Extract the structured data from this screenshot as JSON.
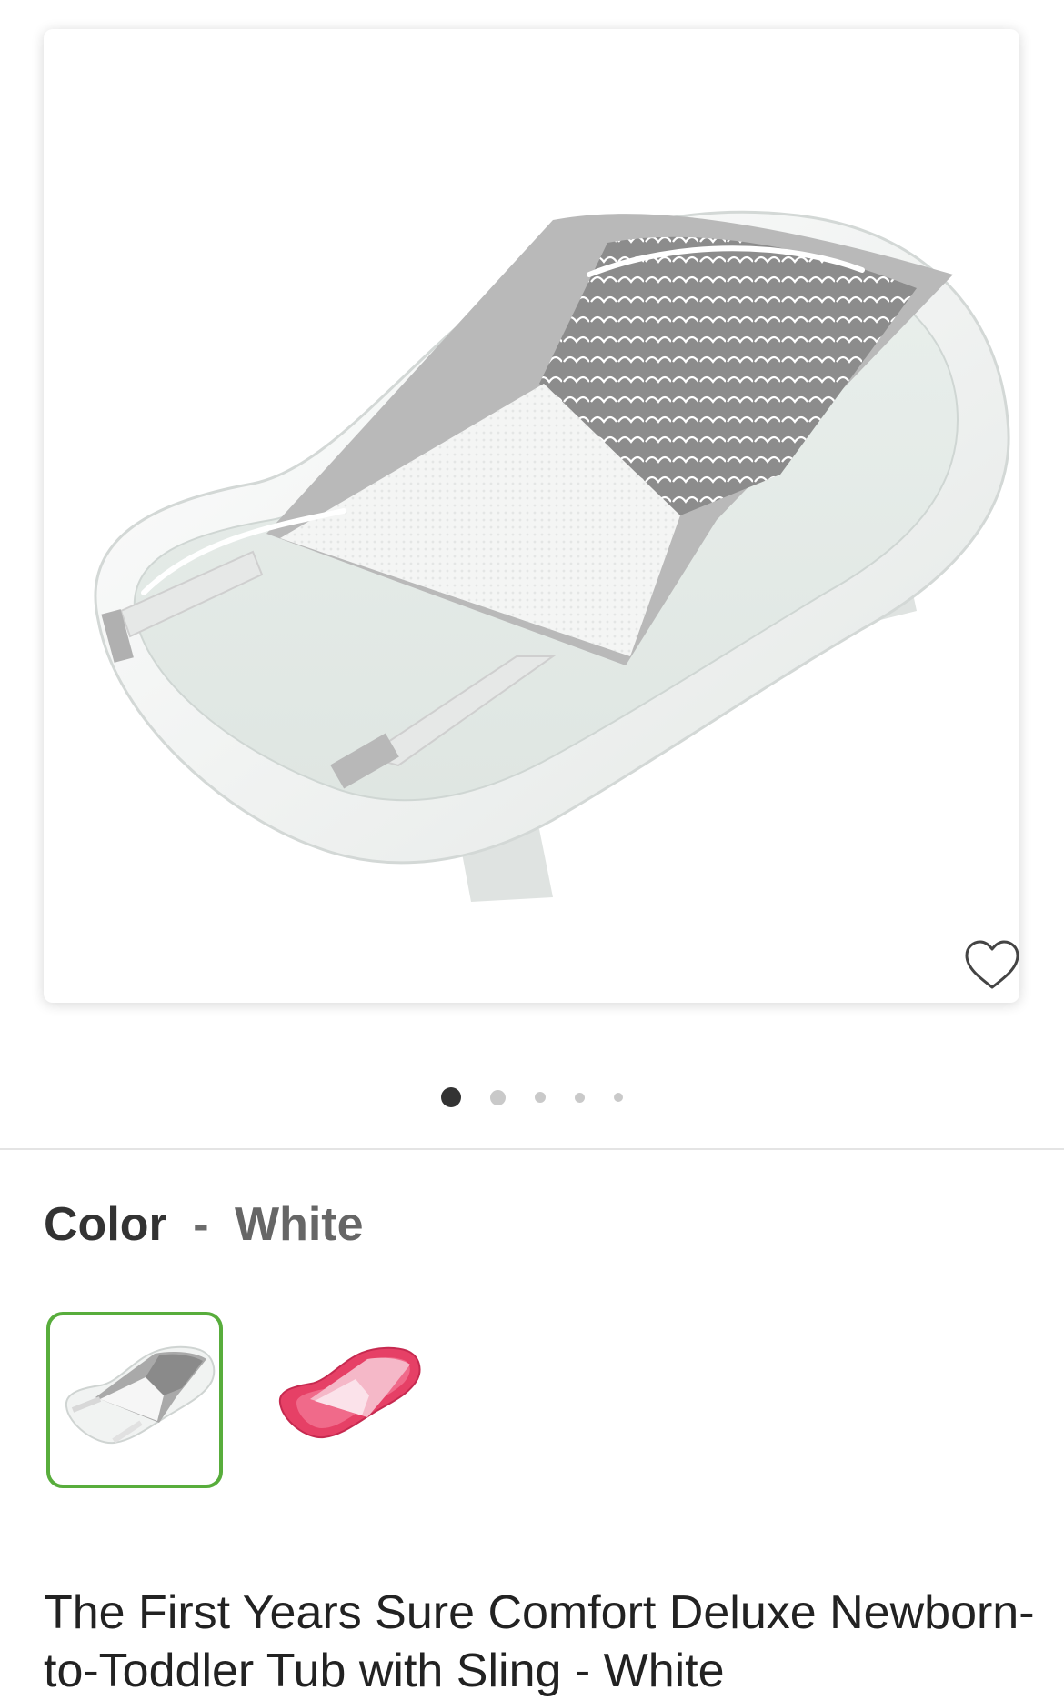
{
  "product_image": {
    "icon": "baby-bathtub-with-sling-image",
    "tub_color": "#f2f4f3",
    "sling_accent": "#8c8c8c"
  },
  "favorite": {
    "icon": "heart-outline-icon"
  },
  "carousel": {
    "total_images": 5,
    "active_index": 0
  },
  "color_selector": {
    "label": "Color",
    "separator": "-",
    "selected_value": "White",
    "selected_border_color": "#58ad3c",
    "options": [
      {
        "name": "White",
        "icon": "white-tub-thumbnail",
        "selected": true
      },
      {
        "name": "Pink",
        "icon": "pink-tub-thumbnail",
        "selected": false,
        "swatch_color": "#e64066"
      }
    ]
  },
  "product": {
    "title": "The First Years Sure Comfort Deluxe Newborn-to-Toddler Tub with Sling - White"
  }
}
